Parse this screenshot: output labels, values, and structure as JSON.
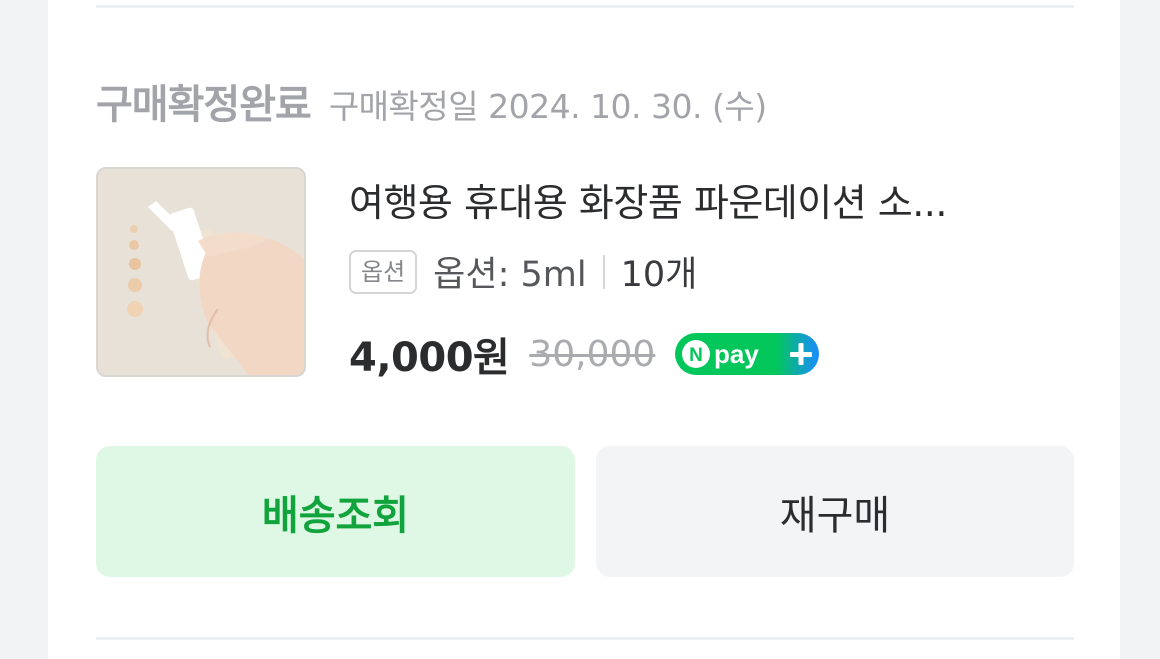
{
  "status": {
    "title": "구매확정완료",
    "date_text": "구매확정일 2024. 10. 30. (수)"
  },
  "product": {
    "name": "여행용 휴대용 화장품 파운데이션 소...",
    "option_badge": "옵션",
    "option_text": "옵션: 5ml",
    "quantity": "10개",
    "price": "4,000원",
    "original_price": "30,000",
    "pay_badge": "Npay+"
  },
  "actions": {
    "track_label": "배송조회",
    "reorder_label": "재구매"
  },
  "colors": {
    "accent_green": "#12a43c",
    "track_bg": "#def8e5",
    "secondary_bg": "#f3f4f6",
    "muted_text": "#a2a4a9"
  }
}
